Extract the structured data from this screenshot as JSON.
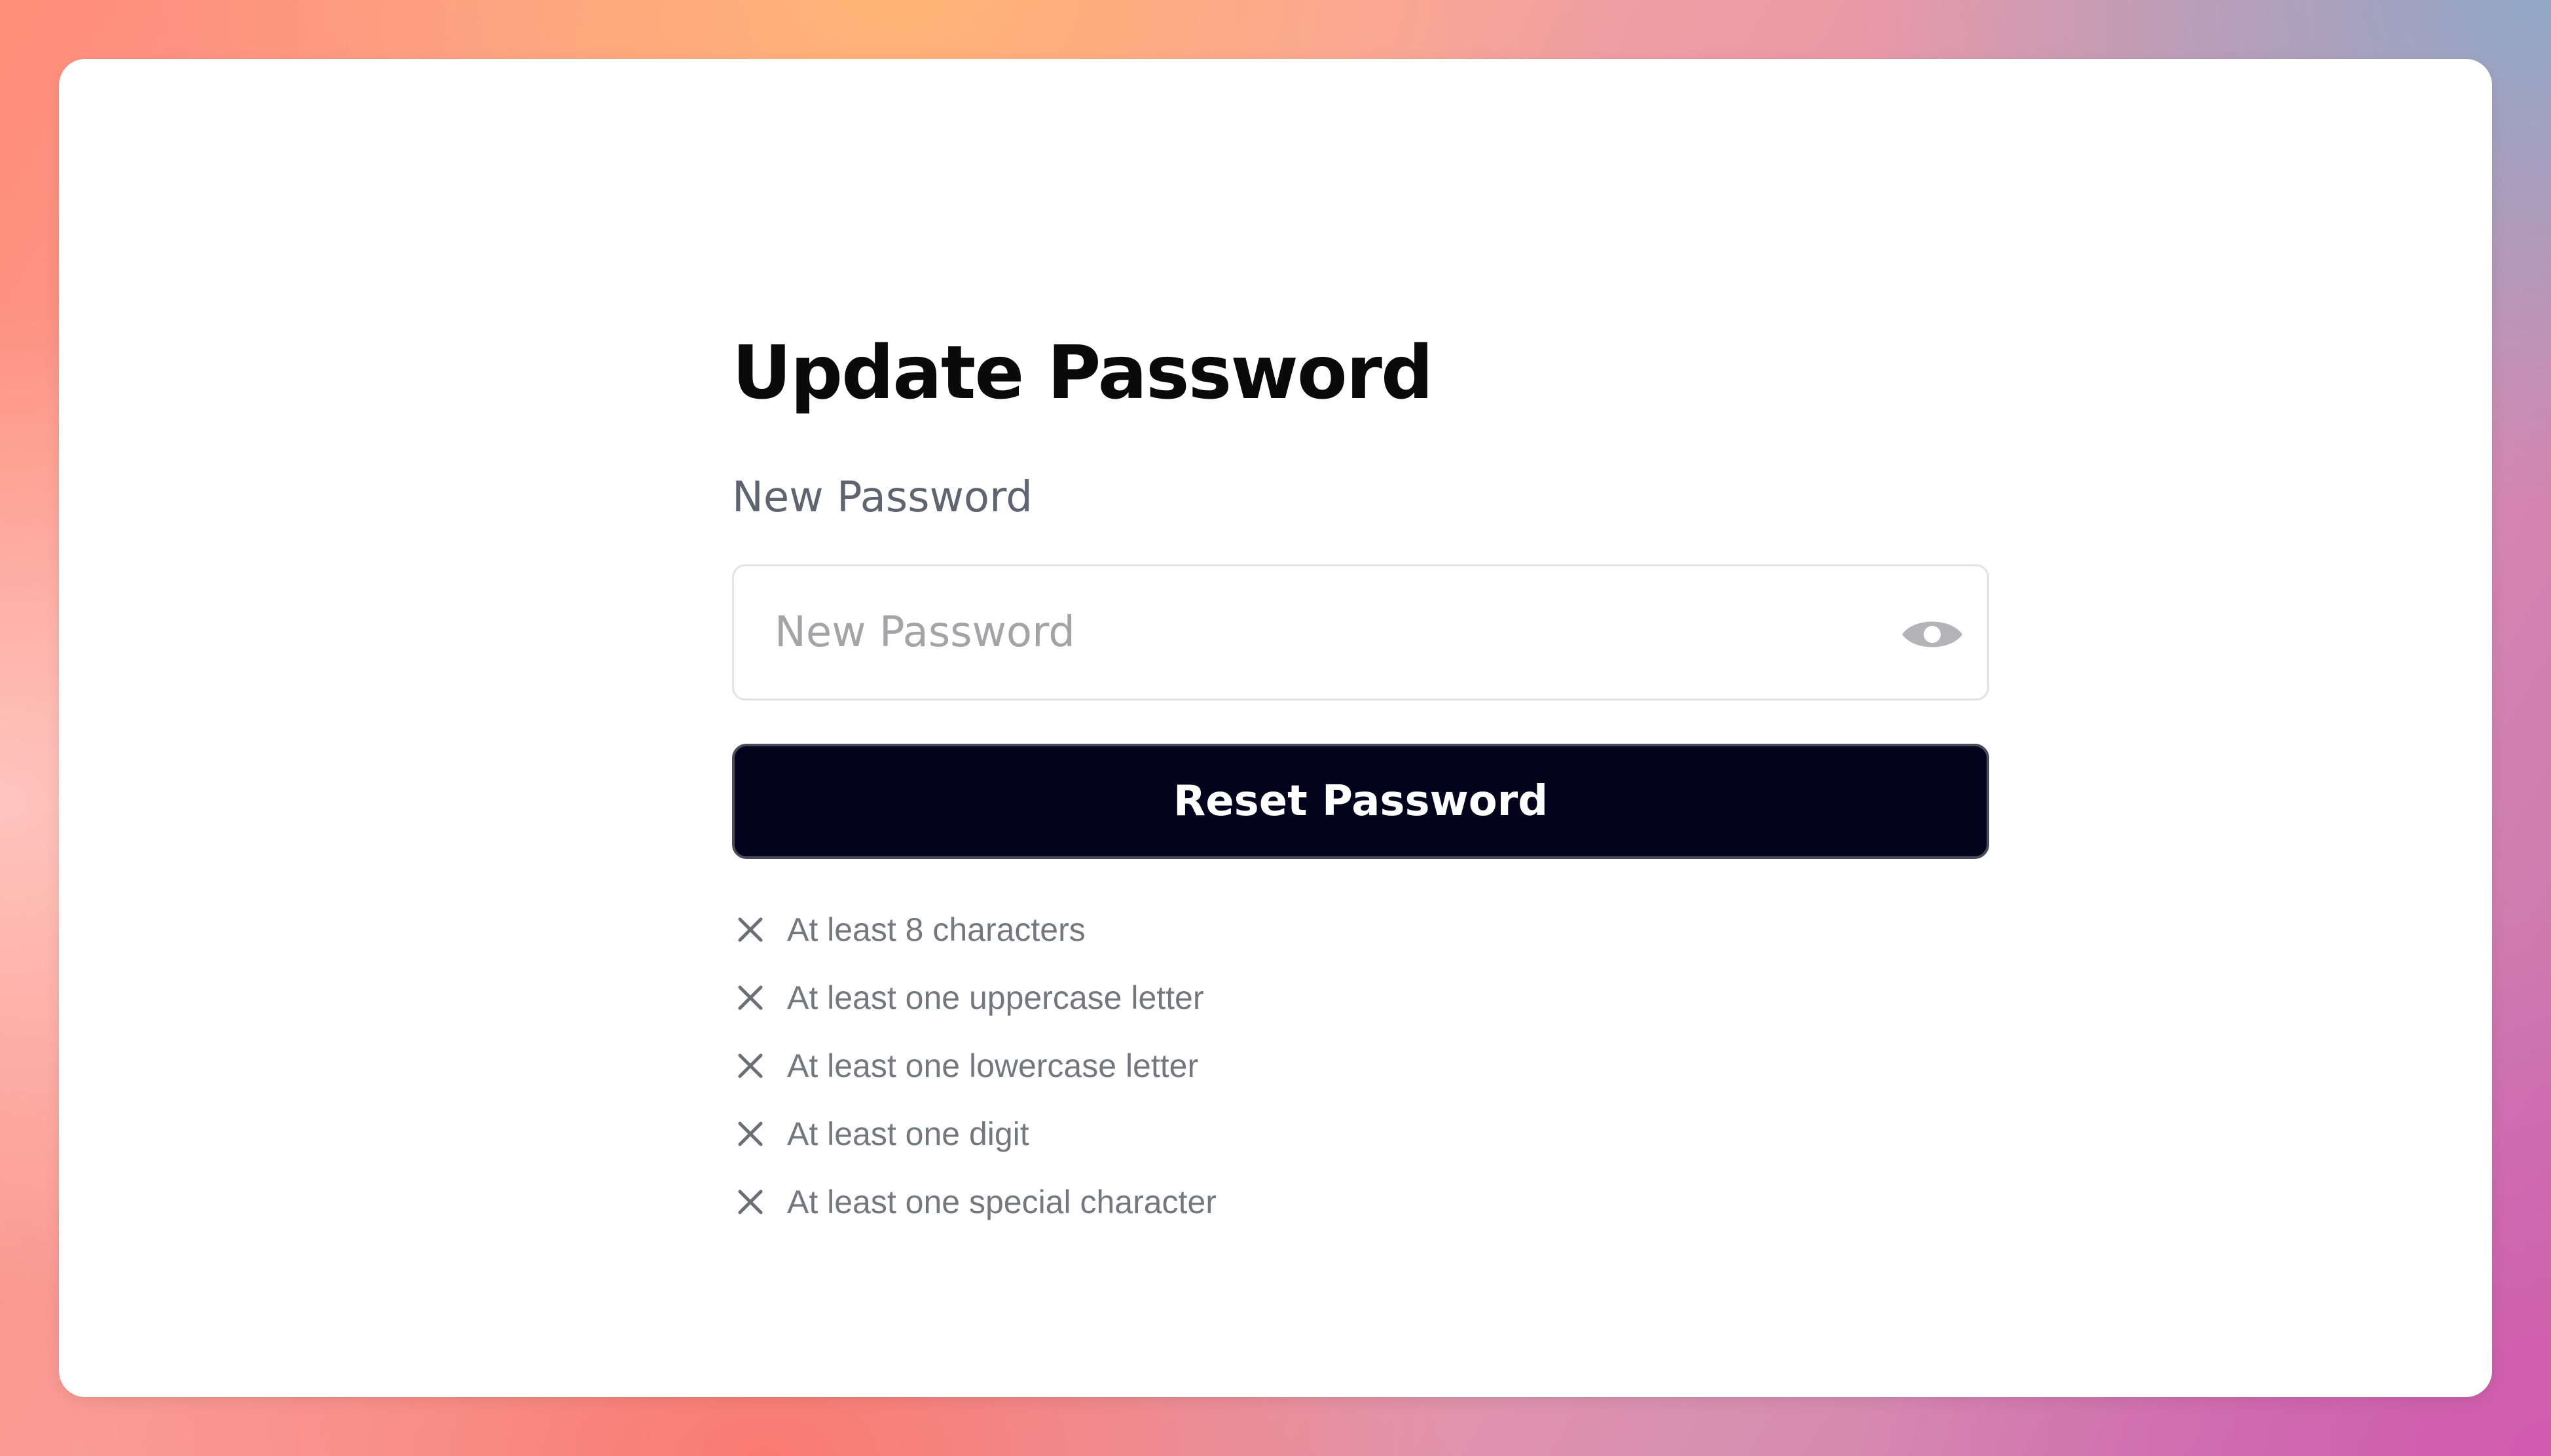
{
  "form": {
    "title": "Update Password",
    "password_label": "New Password",
    "password_placeholder": "New Password",
    "password_value": "",
    "toggle_icon": "eye-icon",
    "submit_label": "Reset Password"
  },
  "requirements": [
    {
      "text": "At least 8 characters",
      "met": false,
      "icon": "x-icon"
    },
    {
      "text": "At least one uppercase letter",
      "met": false,
      "icon": "x-icon"
    },
    {
      "text": "At least one lowercase letter",
      "met": false,
      "icon": "x-icon"
    },
    {
      "text": "At least one digit",
      "met": false,
      "icon": "x-icon"
    },
    {
      "text": "At least one special character",
      "met": false,
      "icon": "x-icon"
    }
  ],
  "colors": {
    "button_bg": "#03031e",
    "button_text": "#ffffff",
    "label": "#5f6570",
    "requirement_text": "#74777d",
    "unmet_icon": "#6b6e74"
  }
}
